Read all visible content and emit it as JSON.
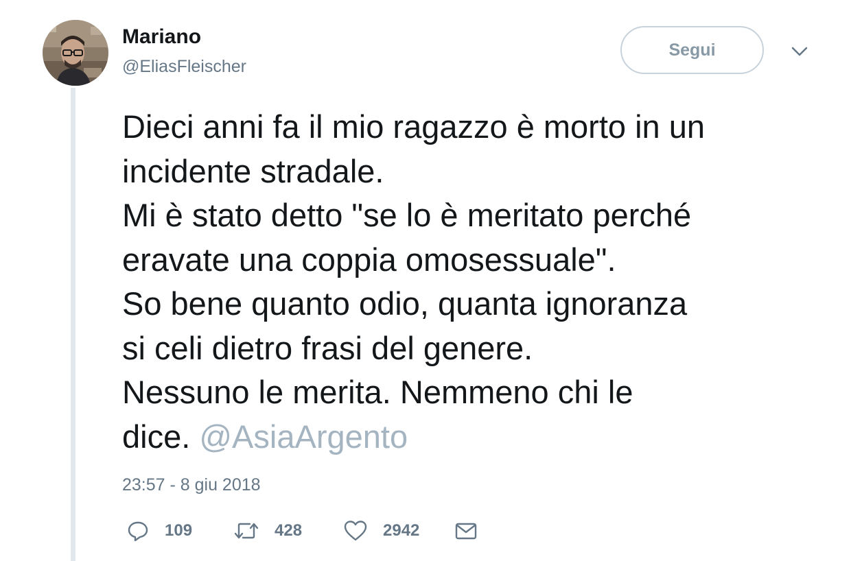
{
  "author": {
    "display_name": "Mariano",
    "handle": "@EliasFleischer"
  },
  "follow_button": {
    "label": "Segui"
  },
  "tweet": {
    "text_lines": [
      "Dieci anni fa il mio ragazzo è morto in un",
      "incidente stradale.",
      "Mi è stato detto \"se lo è meritato perché",
      "eravate una coppia omosessuale\".",
      "So bene quanto odio, quanta ignoranza",
      "si celi dietro frasi del genere.",
      "Nessuno le merita. Nemmeno chi le",
      "dice. "
    ],
    "mention": "@AsiaArgento",
    "timestamp": "23:57 - 8 giu 2018"
  },
  "actions": {
    "reply": {
      "icon": "reply-icon",
      "count": "109"
    },
    "retweet": {
      "icon": "retweet-icon",
      "count": "428"
    },
    "like": {
      "icon": "heart-icon",
      "count": "2942"
    },
    "direct_message": {
      "icon": "envelope-icon"
    }
  },
  "colors": {
    "text": "#14171a",
    "secondary": "#657786",
    "mention": "#a4b4c1",
    "thread_line": "#e1e8ed"
  }
}
